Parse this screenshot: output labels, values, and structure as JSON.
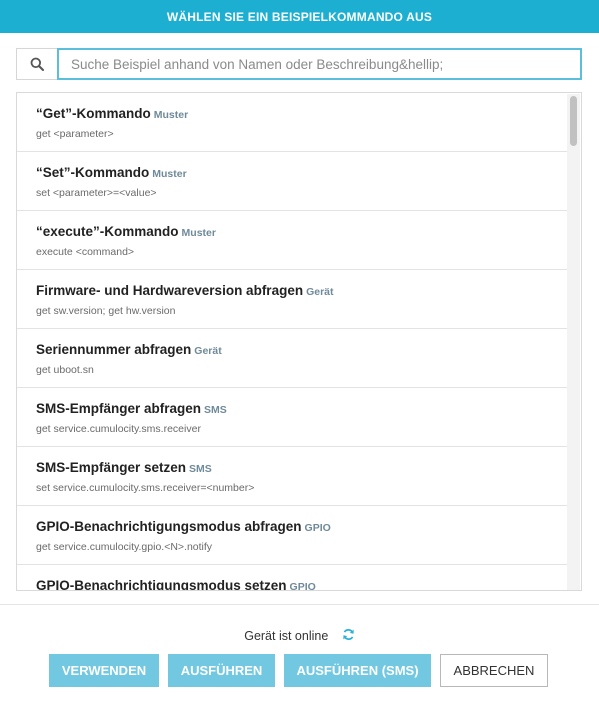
{
  "dialog": {
    "title": "WÄHLEN SIE EIN BEISPIELKOMMANDO AUS"
  },
  "search": {
    "placeholder": "Suche Beispiel anhand von Namen oder Beschreibung&hellip;",
    "icon": "search-icon"
  },
  "commands": [
    {
      "title": "“Get”-Kommando",
      "tag": "Muster",
      "command": "get <parameter>"
    },
    {
      "title": "“Set”-Kommando",
      "tag": "Muster",
      "command": "set <parameter>=<value>"
    },
    {
      "title": "“execute”-Kommando",
      "tag": "Muster",
      "command": "execute <command>"
    },
    {
      "title": "Firmware- und Hardwareversion abfragen",
      "tag": "Gerät",
      "command": "get sw.version; get hw.version"
    },
    {
      "title": "Seriennummer abfragen",
      "tag": "Gerät",
      "command": "get uboot.sn"
    },
    {
      "title": "SMS-Empfänger abfragen",
      "tag": "SMS",
      "command": "get service.cumulocity.sms.receiver"
    },
    {
      "title": "SMS-Empfänger setzen",
      "tag": "SMS",
      "command": "set service.cumulocity.sms.receiver=<number>"
    },
    {
      "title": "GPIO-Benachrichtigungsmodus abfragen",
      "tag": "GPIO",
      "command": "get service.cumulocity.gpio.<N>.notify"
    },
    {
      "title": "GPIO-Benachrichtigungsmodus setzen",
      "tag": "GPIO",
      "command": ""
    }
  ],
  "footer": {
    "status": "Gerät ist online",
    "buttons": {
      "use": "VERWENDEN",
      "execute": "AUSFÜHREN",
      "execute_sms": "AUSFÜHREN (SMS)",
      "cancel": "ABBRECHEN"
    }
  },
  "colors": {
    "accent": "#1dafd2",
    "button": "#72c8e0",
    "input_border": "#5bbfdb"
  }
}
